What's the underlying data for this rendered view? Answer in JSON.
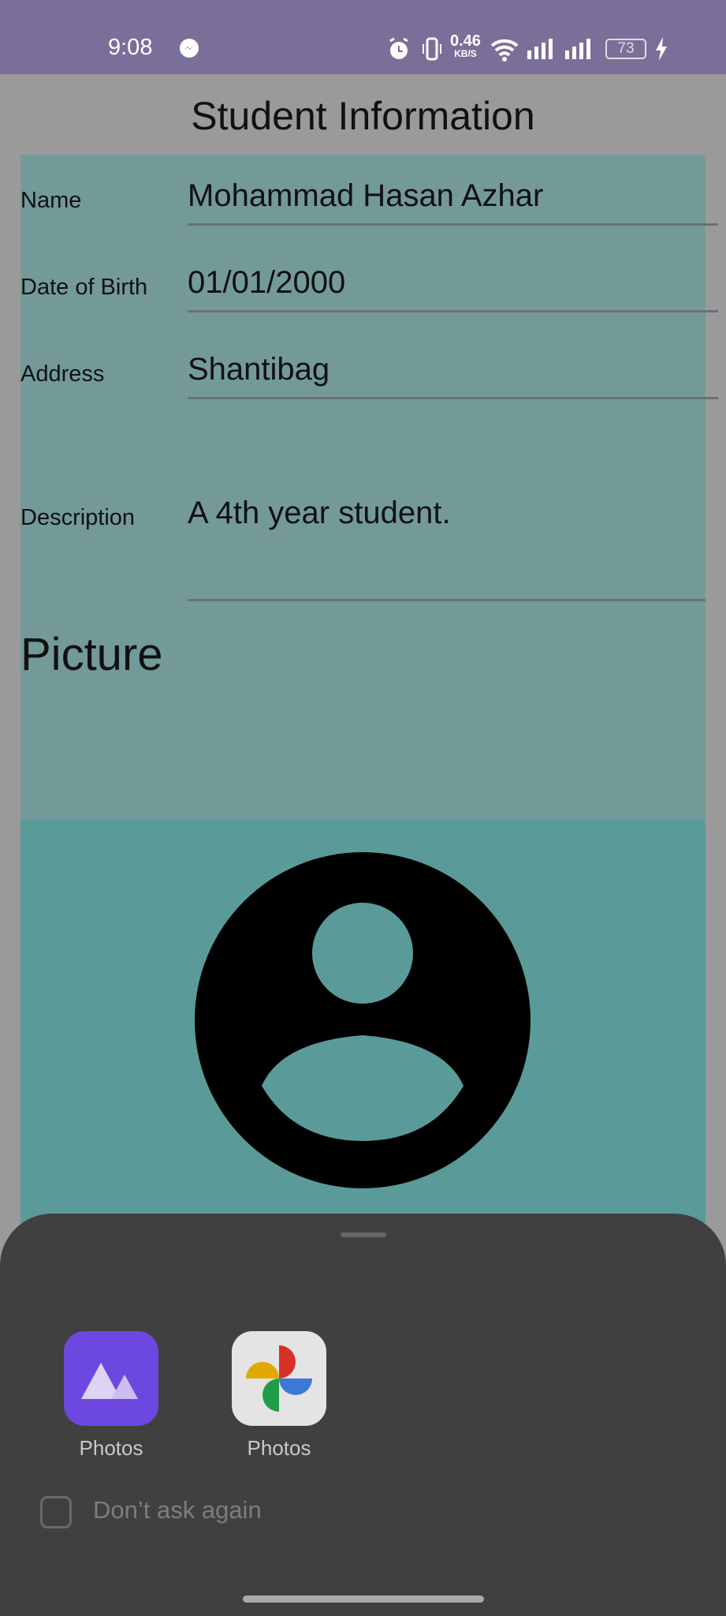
{
  "status_bar": {
    "time": "9:08",
    "net_speed": "0.46",
    "net_unit": "KB/S",
    "battery": "73",
    "icons": [
      "messenger-icon",
      "alarm-icon",
      "vibrate-icon",
      "wifi-icon",
      "signal-icon",
      "signal-icon",
      "battery-icon",
      "charging-icon"
    ]
  },
  "page": {
    "title": "Student Information"
  },
  "form": {
    "fields": [
      {
        "label": "Name",
        "value": "Mohammad Hasan Azhar"
      },
      {
        "label": "Date of Birth",
        "value": "01/01/2000"
      },
      {
        "label": "Address",
        "value": "Shantibag"
      },
      {
        "label": "Description",
        "value": "A 4th year student."
      }
    ],
    "picture_heading": "Picture"
  },
  "chooser": {
    "apps": [
      {
        "label": "Photos",
        "icon": "gallery-icon"
      },
      {
        "label": "Photos",
        "icon": "google-photos-icon"
      }
    ],
    "dont_ask_again": "Don’t ask again",
    "dont_ask_checked": false
  },
  "colors": {
    "status_bar": "#7a6f99",
    "form_bg": "#739a99",
    "image_bg": "#5a9b99",
    "sheet_bg": "#404040"
  }
}
